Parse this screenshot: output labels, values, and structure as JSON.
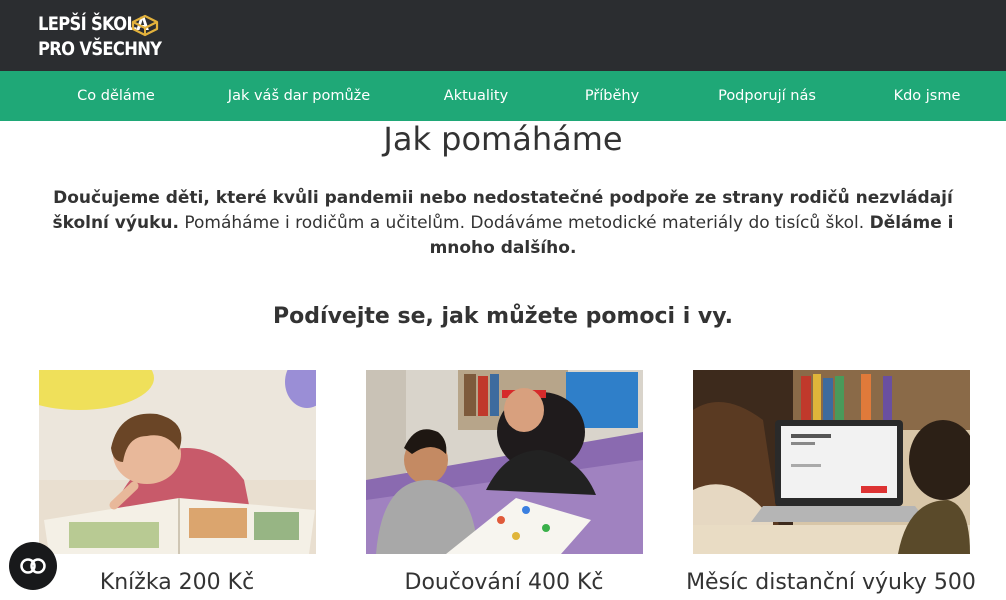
{
  "header": {
    "logo_line1": "LEPŠÍ ŠKOLA",
    "logo_line2": "PRO VŠECHNY",
    "logo_icon": "book-icon",
    "background_color": "#2b2d30",
    "accent_color": "#e3b23c"
  },
  "nav": {
    "background_color": "#1fa877",
    "items": [
      {
        "label": "Co děláme"
      },
      {
        "label": "Jak váš dar pomůže"
      },
      {
        "label": "Aktuality"
      },
      {
        "label": "Příběhy"
      },
      {
        "label": "Podporují nás"
      },
      {
        "label": "Kdo jsme"
      }
    ]
  },
  "main": {
    "title": "Jak pomáháme",
    "intro_bold1": "Doučujeme děti, které kvůli pandemii nebo nedostatečné podpoře ze strany rodičů nezvládají školní výuku.",
    "intro_text": " Pomáháme i rodičům a učitelům. Dodáváme metodické materiály do tisíců škol. ",
    "intro_bold2": "Děláme i mnoho dalšího.",
    "subtitle": "Podívejte se, jak můžete pomoci i vy."
  },
  "cards": [
    {
      "title": "Knížka 200 Kč",
      "image": "boy-reading-book-photo"
    },
    {
      "title": "Doučování 400 Kč",
      "image": "tutoring-session-photo"
    },
    {
      "title": "Měsíc distanční výuky 500",
      "image": "laptop-distance-learning-photo"
    }
  ],
  "accessibility": {
    "icon": "accessibility-icon"
  }
}
